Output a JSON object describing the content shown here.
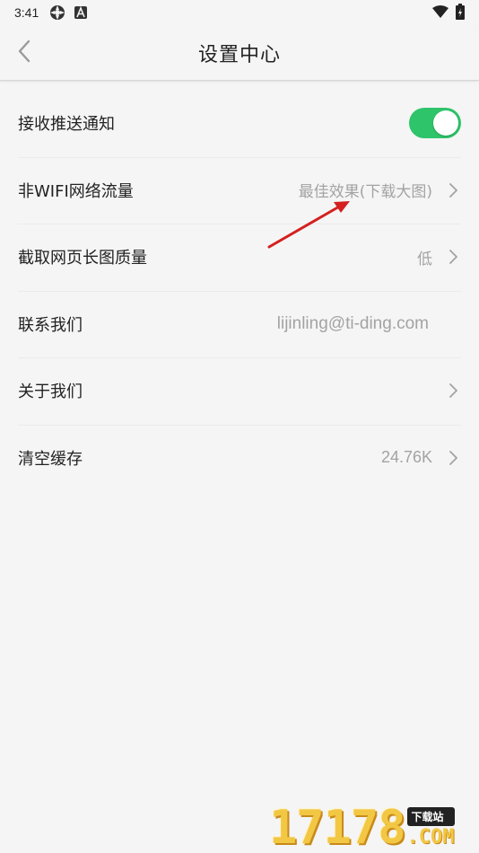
{
  "status_bar": {
    "time": "3:41",
    "icons": [
      "app-notification-icon",
      "a-notification-icon"
    ],
    "right_icons": [
      "wifi-icon",
      "battery-icon"
    ]
  },
  "header": {
    "title": "设置中心",
    "back_icon": "chevron-left-icon"
  },
  "settings": {
    "push": {
      "label": "接收推送通知",
      "enabled": true
    },
    "non_wifi": {
      "label": "非WIFI网络流量",
      "value": "最佳效果(下载大图)"
    },
    "screenshot_quality": {
      "label": "截取网页长图质量",
      "value": "低"
    },
    "contact": {
      "label": "联系我们",
      "value": "lijinling@ti-ding.com"
    },
    "about": {
      "label": "关于我们"
    },
    "clear_cache": {
      "label": "清空缓存",
      "value": "24.76K"
    }
  },
  "watermark": {
    "number": "17178",
    "tag": "下载站",
    "suffix": ".COM"
  },
  "colors": {
    "background": "#f5f5f5",
    "toggle_on": "#2ec46a",
    "value_text": "#a3a3a3",
    "annotation_arrow": "#d42020"
  }
}
